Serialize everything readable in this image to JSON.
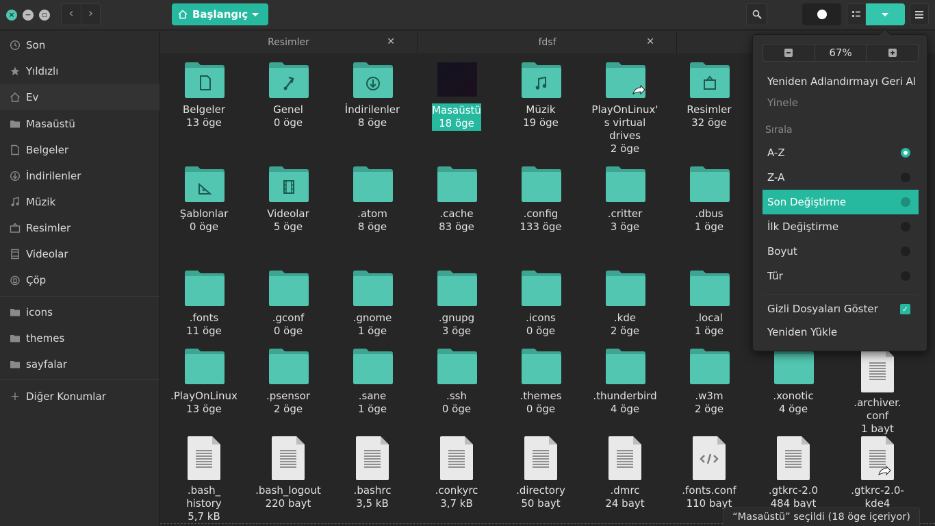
{
  "headerbar": {
    "path_label": "Başlangıç"
  },
  "sidebar": {
    "items": [
      {
        "label": "Son",
        "icon": "clock-icon"
      },
      {
        "label": "Yıldızlı",
        "icon": "star-icon"
      },
      {
        "label": "Ev",
        "icon": "home-icon"
      },
      {
        "label": "Masaüstü",
        "icon": "folder-icon"
      },
      {
        "label": "Belgeler",
        "icon": "document-icon"
      },
      {
        "label": "İndirilenler",
        "icon": "download-icon"
      },
      {
        "label": "Müzik",
        "icon": "music-icon"
      },
      {
        "label": "Resimler",
        "icon": "pictures-icon"
      },
      {
        "label": "Videolar",
        "icon": "video-icon"
      },
      {
        "label": "Çöp",
        "icon": "trash-icon"
      }
    ],
    "bookmarks": [
      {
        "label": "icons",
        "icon": "folder-icon"
      },
      {
        "label": "themes",
        "icon": "folder-icon"
      },
      {
        "label": "sayfalar",
        "icon": "folder-icon"
      }
    ],
    "other_locations": "Diğer Konumlar"
  },
  "tabs": [
    {
      "label": "Resimler"
    },
    {
      "label": "fdsf"
    }
  ],
  "grid": {
    "items": [
      {
        "name": "Belgeler",
        "meta": "13 öge",
        "icon": "folder-documents-icon"
      },
      {
        "name": "Genel",
        "meta": "0 öge",
        "icon": "folder-public-icon"
      },
      {
        "name": "İndirilenler",
        "meta": "8 öge",
        "icon": "folder-download-icon"
      },
      {
        "name": "Masaüstü",
        "meta": "18 öge",
        "icon": "desktop-thumbnail-icon",
        "selected": true
      },
      {
        "name": "Müzik",
        "meta": "19 öge",
        "icon": "folder-music-icon"
      },
      {
        "name": "PlayOnLinux'\ns virtual\ndrives",
        "meta": "2 öge",
        "icon": "folder-link-icon"
      },
      {
        "name": "Resimler",
        "meta": "32 öge",
        "icon": "folder-pictures-icon"
      },
      {
        "name": "Şablonlar",
        "meta": "0 öge",
        "icon": "folder-templates-icon"
      },
      {
        "name": "Videolar",
        "meta": "5 öge",
        "icon": "folder-videos-icon"
      },
      {
        "name": ".atom",
        "meta": "8 öge",
        "icon": "folder-icon"
      },
      {
        "name": ".cache",
        "meta": "83 öge",
        "icon": "folder-icon"
      },
      {
        "name": ".config",
        "meta": "133 öge",
        "icon": "folder-icon"
      },
      {
        "name": ".critter",
        "meta": "3 öge",
        "icon": "folder-icon"
      },
      {
        "name": ".dbus",
        "meta": "1 öge",
        "icon": "folder-icon"
      },
      {
        "name": ".fonts",
        "meta": "11 öge",
        "icon": "folder-icon"
      },
      {
        "name": ".gconf",
        "meta": "0 öge",
        "icon": "folder-icon"
      },
      {
        "name": ".gnome",
        "meta": "1 öge",
        "icon": "folder-icon"
      },
      {
        "name": ".gnupg",
        "meta": "3 öge",
        "icon": "folder-icon"
      },
      {
        "name": ".icons",
        "meta": "0 öge",
        "icon": "folder-icon"
      },
      {
        "name": ".kde",
        "meta": "2 öge",
        "icon": "folder-icon"
      },
      {
        "name": ".local",
        "meta": "1 öge",
        "icon": "folder-icon"
      },
      {
        "name": ".PlayOnLinux",
        "meta": "13 öge",
        "icon": "folder-icon"
      },
      {
        "name": ".psensor",
        "meta": "2 öge",
        "icon": "folder-icon"
      },
      {
        "name": ".sane",
        "meta": "1 öge",
        "icon": "folder-icon"
      },
      {
        "name": ".ssh",
        "meta": "0 öge",
        "icon": "folder-icon"
      },
      {
        "name": ".themes",
        "meta": "0 öge",
        "icon": "folder-icon"
      },
      {
        "name": ".thunderbird",
        "meta": "4 öge",
        "icon": "folder-icon"
      },
      {
        "name": ".w3m",
        "meta": "2 öge",
        "icon": "folder-icon"
      },
      {
        "name": ".xonotic",
        "meta": "4 öge",
        "icon": "folder-icon"
      },
      {
        "name": ".archiver.\nconf",
        "meta": "1 bayt",
        "icon": "text-file-icon"
      },
      {
        "name": ".bash_\nhistory",
        "meta": "5,7 kB",
        "icon": "text-file-icon"
      },
      {
        "name": ".bash_logout",
        "meta": "220 bayt",
        "icon": "text-file-icon"
      },
      {
        "name": ".bashrc",
        "meta": "3,5 kB",
        "icon": "text-file-icon"
      },
      {
        "name": ".conkyrc",
        "meta": "3,7 kB",
        "icon": "text-file-icon"
      },
      {
        "name": ".directory",
        "meta": "50 bayt",
        "icon": "text-file-icon"
      },
      {
        "name": ".dmrc",
        "meta": "24 bayt",
        "icon": "text-file-icon"
      },
      {
        "name": ".fonts.conf",
        "meta": "110 bayt",
        "icon": "code-file-icon"
      },
      {
        "name": ".gtkrc-2.0",
        "meta": "484 bayt",
        "icon": "text-file-icon"
      },
      {
        "name": ".gtkrc-2.0-\nkde4",
        "meta": "",
        "icon": "text-file-link-icon"
      }
    ]
  },
  "popover": {
    "zoom_level": "67%",
    "undo_rename": "Yeniden Adlandırmayı Geri Al",
    "redo": "Yinele",
    "sort_heading": "Sırala",
    "sort_options": [
      {
        "label": "A-Z",
        "checked": true
      },
      {
        "label": "Z-A",
        "checked": false
      },
      {
        "label": "Son Değiştirme",
        "checked": false,
        "hover": true
      },
      {
        "label": "İlk Değiştirme",
        "checked": false
      },
      {
        "label": "Boyut",
        "checked": false
      },
      {
        "label": "Tür",
        "checked": false
      }
    ],
    "show_hidden": "Gizli Dosyaları Göster",
    "reload": "Yeniden Yükle"
  },
  "statusbar": {
    "text": "“Masaüstü” seçildi (18 öge içeriyor)"
  },
  "colors": {
    "accent": "#27b9a0",
    "folder": "#4cbfa9"
  }
}
